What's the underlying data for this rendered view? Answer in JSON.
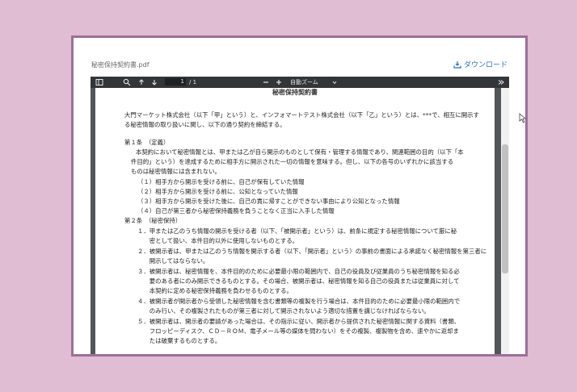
{
  "file_name": "秘密保持契約書.pdf",
  "download_label": "ダウンロード",
  "toolbar": {
    "page_current": "1",
    "page_total": "/ 1",
    "zoom_label": "自動ズーム"
  },
  "document": {
    "title": "秘密保持契約書",
    "intro": "大門マーケット株式会社（以下「甲」という）と、インフォマートテスト株式会社（以下「乙」という）とは、***で、相互に開示する秘密情報の取り扱いに関し、以下の通り契約を締結する。",
    "article1_heading": "第１条　（定義）",
    "article1_lines": [
      "本契約において秘密情報とは、甲または乙が自ら開示のものとして保有・管理する情報であり、関連範囲の目的（以下「本",
      "件目的」という）を達成するために相手方に開示された一切の情報を意味する。但し、以下の各号のいずれかに該当する",
      "ものは秘密情報には含まれない。"
    ],
    "article1_items": [
      "（１）相手方から開示を受ける前に、自己が保有していた情報",
      "（２）相手方から開示を受ける前に、公知となっていた情報",
      "（３）相手方から開示を受けた後に、自己の責に帰すことができない事由により公知となった情報",
      "（４）自己が第三者から秘密保持義務を負うことなく正当に入手した情報"
    ],
    "article2_heading": "第２条　（秘密保持）",
    "article2_items": [
      "１．甲または乙のうち情報の開示を受ける者（以下、「被開示者」という）は、前条に規定する秘密情報について厳に秘",
      "　　密として扱い、本件目的以外に使用しないものとする。",
      "２．被開示者は、甲または乙のうち情報を開示する者（以下、「開示者」という）の事前の書面による承諾なく秘密情報を第三者に",
      "　　開示してはならない。",
      "３．被開示者は、秘密情報を、本件目的のために必要最小限の範囲内で、自己の役員及び従業員のうち秘密情報を知る必",
      "　　要のある者にのみ開示できるものとする。その場合、被開示者は、秘密情報を知る自己の役員または従業員に対して",
      "　　本契約に定める秘密保持義務を負わせるものとする。",
      "４．被開示者が開示者から受領した秘密情報を含む書類等の複製を行う場合は、本件目的のために必要最小限の範囲内で",
      "　　のみ行い、その複製されたものが第三者に対して開示されないよう適切な措置を講じなければならない。",
      "５．被開示者は、開示者の要請があった場合は、その指示に従い、開示者から提供された秘密情報に関する資料（書類、",
      "　　フロッピーディスク、ＣＤ－ＲＯＭ、電子メール等の媒体を問わない）をその複製、複製物を含め、速やかに返却ま",
      "　　たは破棄するものとする。"
    ]
  }
}
